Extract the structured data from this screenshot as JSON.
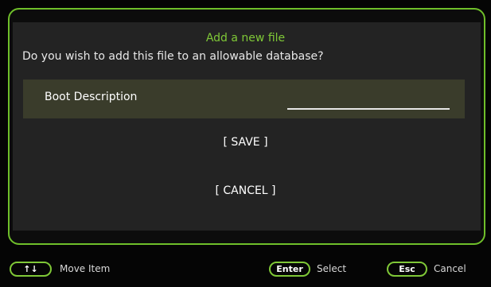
{
  "dialog": {
    "title": "Add a new file",
    "question": "Do you wish to add this file to an allowable database?",
    "field": {
      "label": "Boot Description",
      "value": ""
    },
    "buttons": {
      "save": "[ SAVE ]",
      "cancel": "[ CANCEL ]"
    }
  },
  "footer": {
    "hints": [
      {
        "key": "↑↓",
        "label": "Move Item"
      },
      {
        "key": "Enter",
        "label": "Select"
      },
      {
        "key": "Esc",
        "label": "Cancel"
      }
    ]
  },
  "colors": {
    "accent": "#7fc837",
    "background": "#050505",
    "panel": "#232323",
    "field_row": "#3a3c2b"
  }
}
